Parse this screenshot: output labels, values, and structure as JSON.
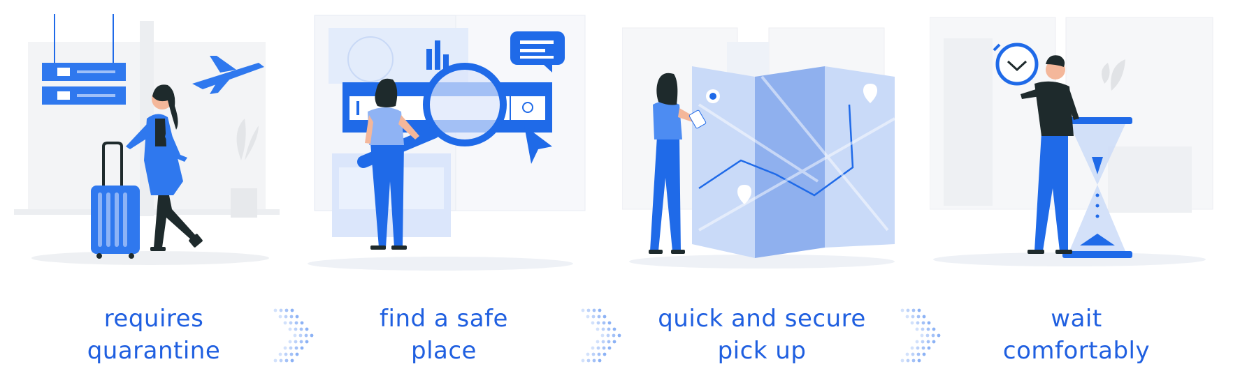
{
  "steps": [
    {
      "line1": "requires",
      "line2": "quarantine"
    },
    {
      "line1": "find a safe",
      "line2": "place"
    },
    {
      "line1": "quick and secure",
      "line2": "pick up"
    },
    {
      "line1": "wait",
      "line2": "comfortably"
    }
  ],
  "colors": {
    "accent": "#1f6ae8",
    "accent_light": "#7ea8f4",
    "accent_pale": "#dbe7fb",
    "bg_gray": "#f1f2f4",
    "dark": "#1e2a2c",
    "skin": "#f4b79a",
    "caption": "#1f5fe0"
  },
  "icons": [
    "plane-icon",
    "luggage-icon",
    "magnifier-icon",
    "chat-bubble-icon",
    "cursor-icon",
    "map-pin-icon",
    "clock-icon",
    "hourglass-icon",
    "chevron-dots-icon"
  ]
}
